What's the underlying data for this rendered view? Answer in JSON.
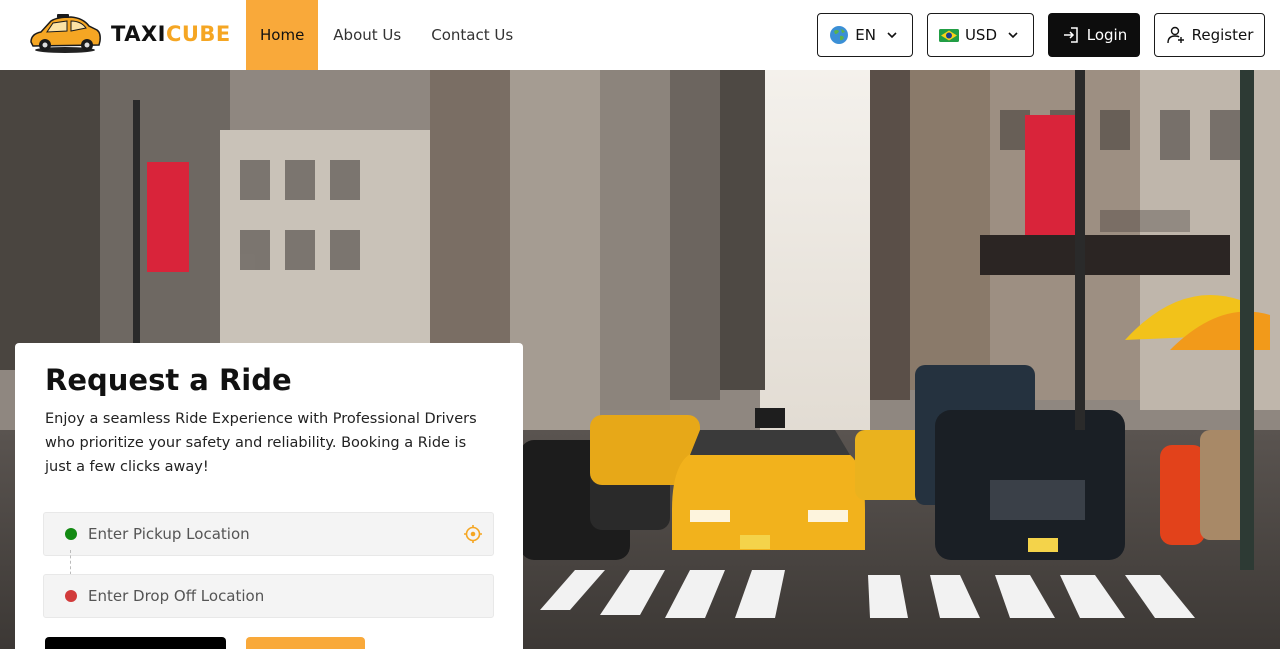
{
  "brand": {
    "name_part1": "TAXI",
    "name_part2": "CUBE",
    "logo_icon": "taxi-car-icon"
  },
  "nav": {
    "items": [
      {
        "label": "Home",
        "active": true
      },
      {
        "label": "About Us"
      },
      {
        "label": "Contact Us"
      }
    ]
  },
  "header_controls": {
    "language": {
      "value": "EN",
      "icon": "globe-flag-icon"
    },
    "currency": {
      "value": "USD",
      "icon": "brazil-flag-icon"
    },
    "login_label": "Login",
    "register_label": "Register"
  },
  "hero": {
    "image": "city-street-taxis-photo"
  },
  "ride_form": {
    "title": "Request a Ride",
    "description": "Enjoy a seamless Ride Experience with Professional Drivers who prioritize your safety and reliability. Booking a Ride is just a few clicks away!",
    "pickup_placeholder": "Enter Pickup Location",
    "drop_placeholder": "Enter Drop Off Location"
  },
  "colors": {
    "accent": "#f9a93a",
    "pickup_dot": "#138a13",
    "drop_dot": "#d23b3b",
    "dark": "#0d0d0d"
  }
}
